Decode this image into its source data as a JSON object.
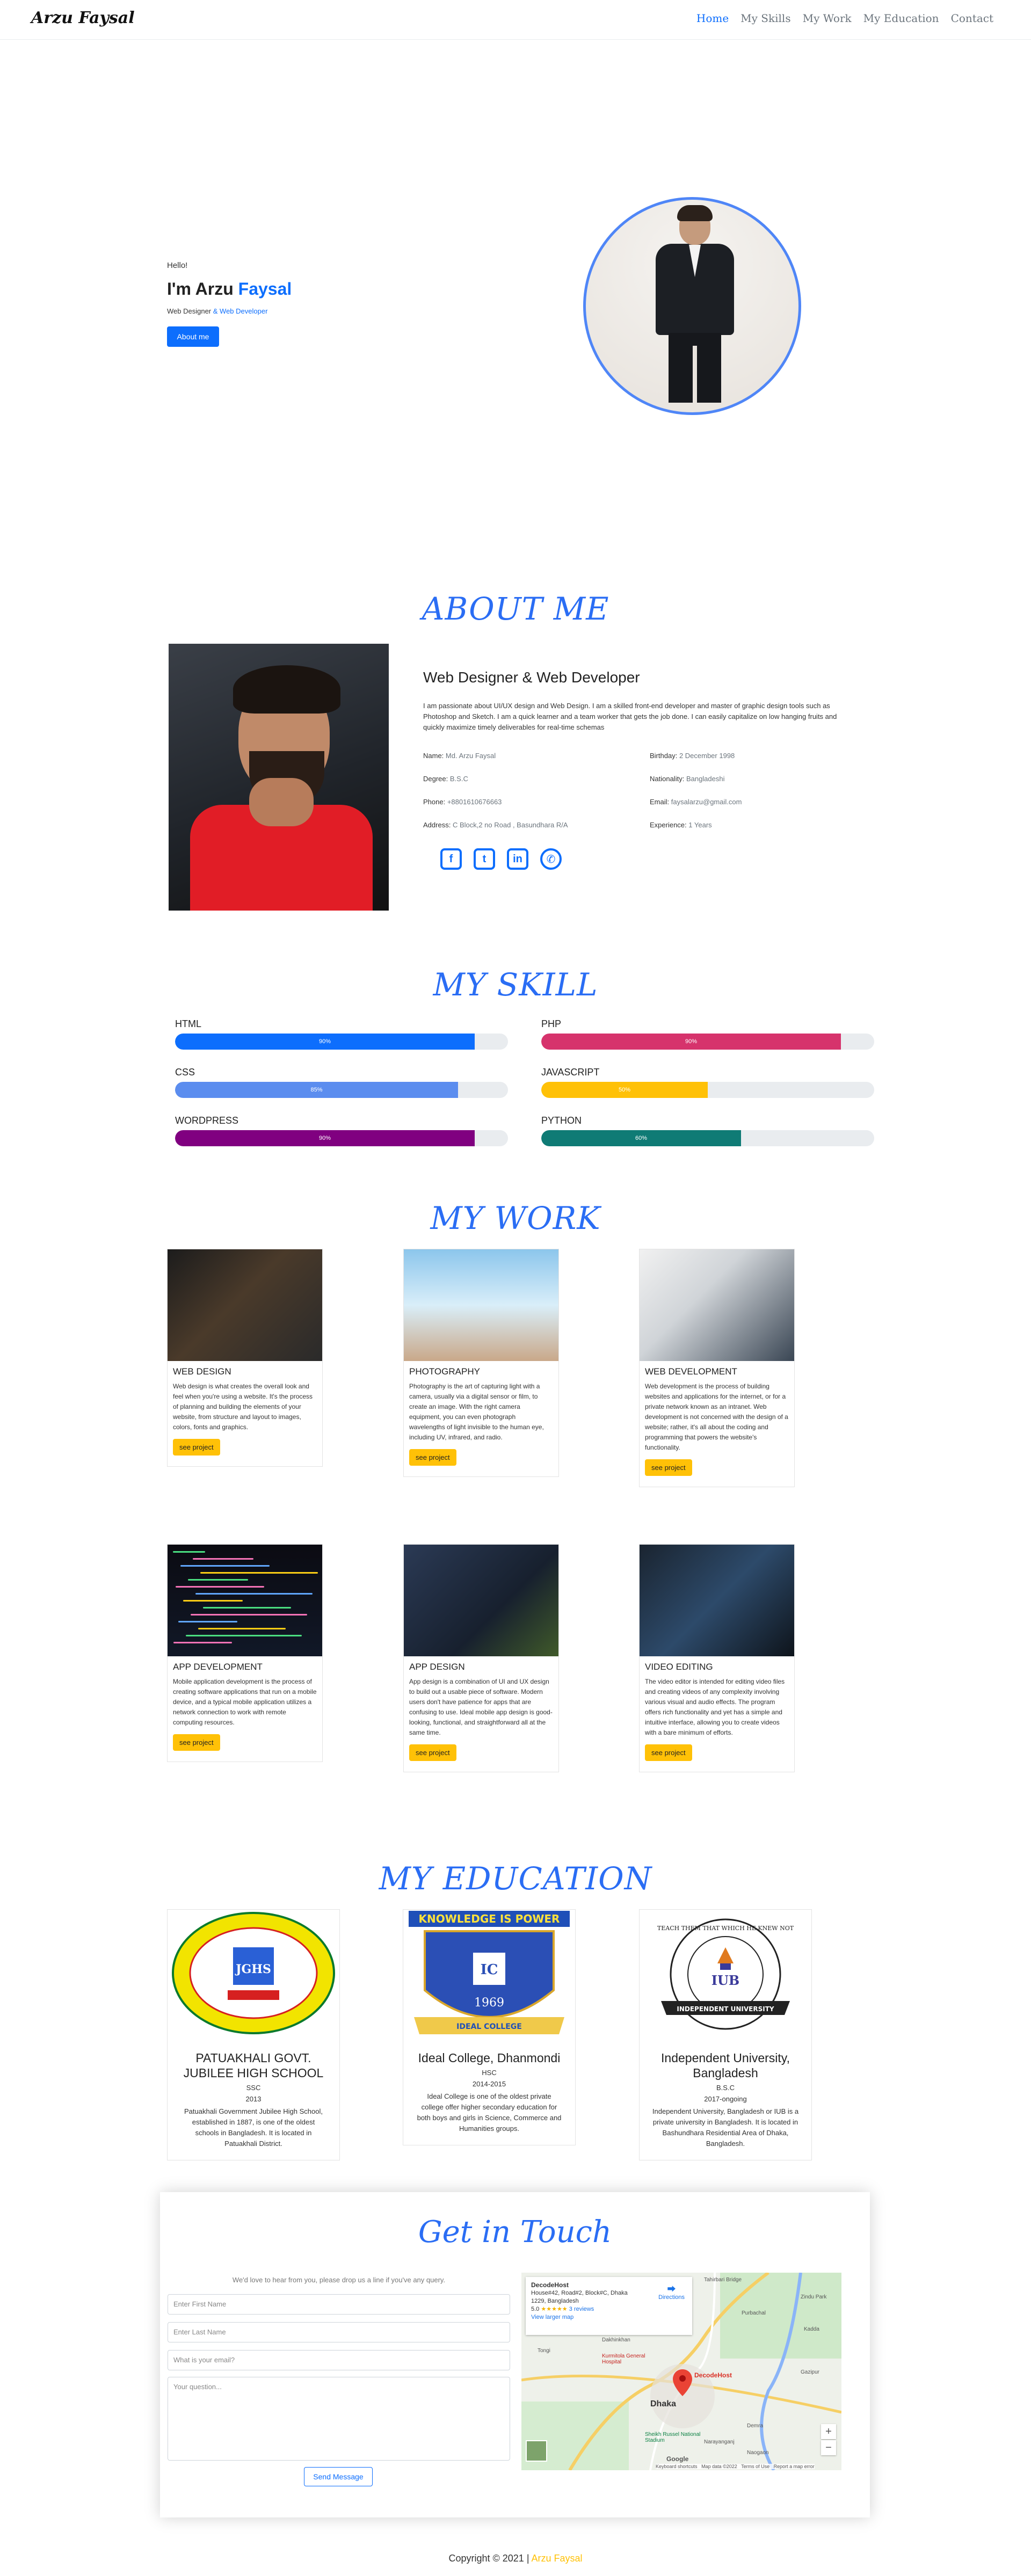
{
  "nav": {
    "brand": "Arzu Faysal",
    "links": [
      "Home",
      "My Skills",
      "My Work",
      "My Education",
      "Contact"
    ]
  },
  "hero": {
    "hello": "Hello!",
    "name_prefix": "I'm Arzu ",
    "name_highlight": "Faysal",
    "role_prefix": "Web Designer ",
    "role_highlight": "& Web Developer",
    "button": "About me"
  },
  "about": {
    "title": "ABOUT ME",
    "heading": "Web Designer & Web Developer",
    "paragraph": "I am passionate about UI/UX design and Web Design. I am a skilled front-end developer and master of graphic design tools such as Photoshop and Sketch. I am a quick learner and a team worker that gets the job done. I can easily capitalize on low hanging fruits and quickly maximize timely deliverables for real-time schemas",
    "info": [
      {
        "label": "Name:",
        "value": "Md. Arzu Faysal"
      },
      {
        "label": "Birthday:",
        "value": "2 December 1998"
      },
      {
        "label": "Degree:",
        "value": "B.S.C"
      },
      {
        "label": "Nationality:",
        "value": "Bangladeshi"
      },
      {
        "label": "Phone:",
        "value": "+8801610676663"
      },
      {
        "label": "Email:",
        "value": "faysalarzu@gmail.com"
      },
      {
        "label": "Address:",
        "value": "C Block,2 no Road , Basundhara R/A"
      },
      {
        "label": "Experience:",
        "value": "1 Years"
      }
    ],
    "socials": [
      "facebook-icon",
      "twitter-icon",
      "linkedin-icon",
      "whatsapp-icon"
    ]
  },
  "skills": {
    "title": "MY SKILL",
    "items": [
      {
        "name": "HTML",
        "level": 90,
        "label": "90%",
        "color": "#0d6efd"
      },
      {
        "name": "PHP",
        "level": 90,
        "label": "90%",
        "color": "#d6336c"
      },
      {
        "name": "CSS",
        "level": 85,
        "label": "85%",
        "color": "#5b8def"
      },
      {
        "name": "JAVASCRIPT",
        "level": 50,
        "label": "50%",
        "color": "#ffc107"
      },
      {
        "name": "WORDPRESS",
        "level": 90,
        "label": "90%",
        "color": "#800080"
      },
      {
        "name": "PYTHON",
        "level": 60,
        "label": "60%",
        "color": "#0f7b75"
      }
    ]
  },
  "work": {
    "title": "MY WORK",
    "button": "see project",
    "cards": [
      {
        "title": "WEB DESIGN",
        "text": "Web design is what creates the overall look and feel when you're using a website. It's the process of planning and building the elements of your website, from structure and layout to images, colors, fonts and graphics."
      },
      {
        "title": "PHOTOGRAPHY",
        "text": "Photography is the art of capturing light with a camera, usually via a digital sensor or film, to create an image. With the right camera equipment, you can even photograph wavelengths of light invisible to the human eye, including UV, infrared, and radio."
      },
      {
        "title": "WEB DEVELOPMENT",
        "text": "Web development is the process of building websites and applications for the internet, or for a private network known as an intranet. Web development is not concerned with the design of a website; rather, it's all about the coding and programming that powers the website's functionality."
      },
      {
        "title": "APP DEVELOPMENT",
        "text": "Mobile application development is the process of creating software applications that run on a mobile device, and a typical mobile application utilizes a network connection to work with remote computing resources."
      },
      {
        "title": "APP DESIGN",
        "text": "App design is a combination of UI and UX design to build out a usable piece of software. Modern users don't have patience for apps that are confusing to use. Ideal mobile app design is good-looking, functional, and straightforward all at the same time."
      },
      {
        "title": "VIDEO EDITING",
        "text": "The video editor is intended for editing video files and creating videos of any complexity involving various visual and audio effects. The program offers rich functionality and yet has a simple and intuitive interface, allowing you to create videos with a bare minimum of efforts."
      }
    ]
  },
  "education": {
    "title": "MY EDUCATION",
    "items": [
      {
        "name": "PATUAKHALI GOVT. JUBILEE HIGH SCHOOL",
        "level": "SSC",
        "year": "2013",
        "text": "Patuakhali Government Jubilee High School, established in 1887, is one of the oldest schools in Bangladesh. It is located in Patuakhali District.",
        "logo_text": "JGHS"
      },
      {
        "name": "Ideal College, Dhanmondi",
        "level": "HSC",
        "year": "2014-2015",
        "text": "Ideal College is one of the oldest private college offer higher secondary education for both boys and girls in Science, Commerce and Humanities groups.",
        "logo_top": "KNOWLEDGE IS POWER",
        "logo_year": "1969",
        "logo_ribbon": "IDEAL COLLEGE"
      },
      {
        "name": "Independent University, Bangladesh",
        "level": "B.S.C",
        "year": "2017-ongoing",
        "text": "Independent University, Bangladesh or IUB is a private university in Bangladesh. It is located in Bashundhara Residential Area of Dhaka, Bangladesh.",
        "logo_text": "IUB",
        "logo_ring": "TEACH THEM THAT WHICH HE KNEW NOT",
        "logo_ribbon": "INDEPENDENT UNIVERSITY"
      }
    ]
  },
  "contact": {
    "title": "Get in Touch",
    "subtitle": "We'd love to hear from you, please drop us a line if you've any query.",
    "first_name": "Enter First Name",
    "last_name": "Enter Last Name",
    "email": "What is your email?",
    "question": "Your question...",
    "send": "Send Message",
    "map": {
      "place": "DecodeHost",
      "address": "House#42, Road#2, Block#C, Dhaka 1229, Bangladesh",
      "rating": "5.0",
      "stars": "★★★★★",
      "reviews": "3 reviews",
      "larger": "View larger map",
      "directions": "Directions",
      "pin_label": "DecodeHost",
      "city": "Dhaka",
      "labels": [
        "Tahirbari Bridge",
        "Zindu Park",
        "Kadda",
        "Dakhinkhan",
        "Tongi",
        "Kurmitola General Hospital",
        "Gazipur",
        "Purbachal",
        "Demra",
        "Narayanganj",
        "Sheikh Russel National Stadium",
        "Naogaon"
      ],
      "footer": [
        "Keyboard shortcuts",
        "Map data ©2022",
        "Terms of Use",
        "Report a map error"
      ],
      "google": "Google",
      "zoom_in": "+",
      "zoom_out": "−"
    }
  },
  "footer": {
    "prefix": "Copyright © 2021 | ",
    "name": "Arzu Faysal"
  }
}
